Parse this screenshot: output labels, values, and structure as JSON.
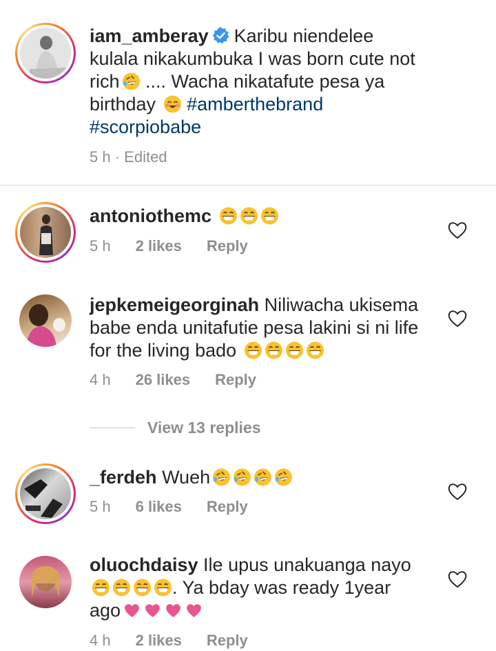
{
  "caption": {
    "username": "iam_amberay",
    "text_1": "Karibu niendelee kulala nikakumbuka I was born cute not rich",
    "text_2": " .... Wacha nikatafute pesa ya birthday ",
    "hashtag_1": "#amberthebrand",
    "hashtag_2": "#scorpiobabe",
    "time": "5 h",
    "separator": " · ",
    "edited": "Edited"
  },
  "comments": [
    {
      "username": "antoniothemc",
      "text": "",
      "time": "5 h",
      "likes": "2 likes",
      "reply": "Reply"
    },
    {
      "username": "jepkemeigeorginah",
      "text": "Niliwacha ukisema babe enda unitafutie pesa lakini si ni life for the living bado",
      "time": "4 h",
      "likes": "26 likes",
      "reply": "Reply"
    },
    {
      "username": "_ferdeh",
      "text": "Wueh",
      "time": "5 h",
      "likes": "6 likes",
      "reply": "Reply"
    },
    {
      "username": "oluochdaisy",
      "text": "Ile upus unakuanga nayo",
      "text_2": ". Ya bday was ready 1year ago",
      "time": "4 h",
      "likes": "2 likes",
      "reply": "Reply"
    }
  ],
  "view_replies": "View 13 replies",
  "colors": {
    "hashtag": "#00376b",
    "meta": "#8e8e8e",
    "verified": "#3897f0",
    "heart_emoji": "#e8558f"
  }
}
